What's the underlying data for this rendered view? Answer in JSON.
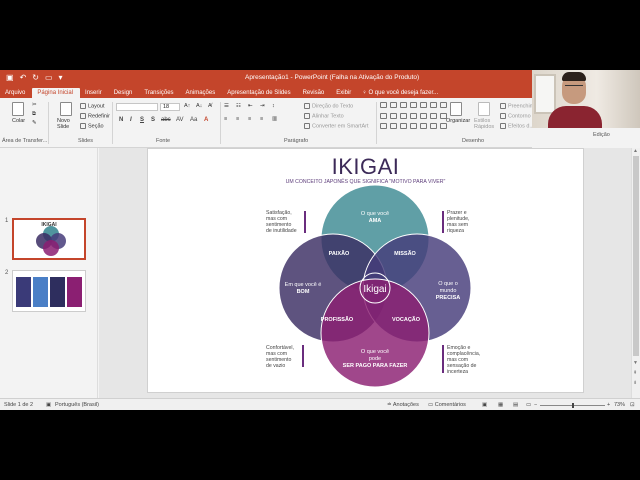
{
  "window": {
    "title": "Apresentação1 - PowerPoint (Falha na Ativação do Produto)"
  },
  "tabs": [
    {
      "label": "Arquivo"
    },
    {
      "label": "Página Inicial"
    },
    {
      "label": "Inserir"
    },
    {
      "label": "Design"
    },
    {
      "label": "Transições"
    },
    {
      "label": "Animações"
    },
    {
      "label": "Apresentação de Slides"
    },
    {
      "label": "Revisão"
    },
    {
      "label": "Exibir"
    }
  ],
  "tell_me": "O que você deseja fazer...",
  "ribbon": {
    "clipboard": {
      "paste": "Colar",
      "label": "Área de Transfer..."
    },
    "slides": {
      "new_slide": "Novo Slide",
      "layout": "Layout",
      "reset": "Redefinir",
      "section": "Seção",
      "label": "Slides"
    },
    "font": {
      "size": "18",
      "bold": "N",
      "italic": "I",
      "underline": "S",
      "shadow": "S",
      "strike": "abc",
      "spacing": "AV",
      "case": "Aa",
      "color": "A",
      "label": "Fonte"
    },
    "paragraph": {
      "direction": "Direção do Texto",
      "align": "Alinhar Texto",
      "smartart": "Converter em SmartArt",
      "label": "Parágrafo"
    },
    "drawing": {
      "arrange": "Organizar",
      "styles": "Estilos Rápidos",
      "fill": "Preenchim...",
      "outline": "Contorno",
      "effects": "Efeitos d...",
      "label": "Desenho"
    },
    "editing": {
      "label": "Edição"
    }
  },
  "thumbnails": [
    {
      "number": "1",
      "mini_title": "IKIGAI"
    },
    {
      "number": "2"
    }
  ],
  "slide": {
    "title": "IKIGAI",
    "subtitle": "UM CONCEITO JAPONÊS QUE SIGNIFICA \"MOTIVO PARA VIVER\"",
    "circles": {
      "top": {
        "line1": "O que você",
        "line2": "AMA",
        "color": "#3d8a93"
      },
      "left": {
        "line1": "Em que você é",
        "line2": "BOM",
        "color": "#3a2d63"
      },
      "right": {
        "line1": "O que o",
        "line1b": "mundo",
        "line2": "PRECISA",
        "color": "#463c7a"
      },
      "bottom": {
        "line1": "O que você",
        "line1b": "pode",
        "line2": "SER PAGO PARA FAZER",
        "color": "#8b1f72"
      }
    },
    "overlaps": {
      "passion": "PAIXÃO",
      "mission": "MISSÃO",
      "profession": "PROFISSÃO",
      "vocation": "VOCAÇÃO",
      "center": "Ikigai"
    },
    "notes": {
      "top_left": [
        "Satisfação,",
        "mas com",
        "sentimento",
        "de inutilidade"
      ],
      "top_right": [
        "Prazer e",
        "plenitude,",
        "mas sem",
        "riqueza"
      ],
      "bottom_left": [
        "Confortável,",
        "mas com",
        "sentimento",
        "de vazio"
      ],
      "bottom_right": [
        "Emoção e",
        "complacência,",
        "mas com",
        "sensação de",
        "incerteza"
      ]
    }
  },
  "status": {
    "slide_of": "Slide 1 de 2",
    "language": "Português (Brasil)",
    "notes": "Anotações",
    "comments": "Comentários",
    "zoom": "73%",
    "zoom_fraction": 0.5
  }
}
